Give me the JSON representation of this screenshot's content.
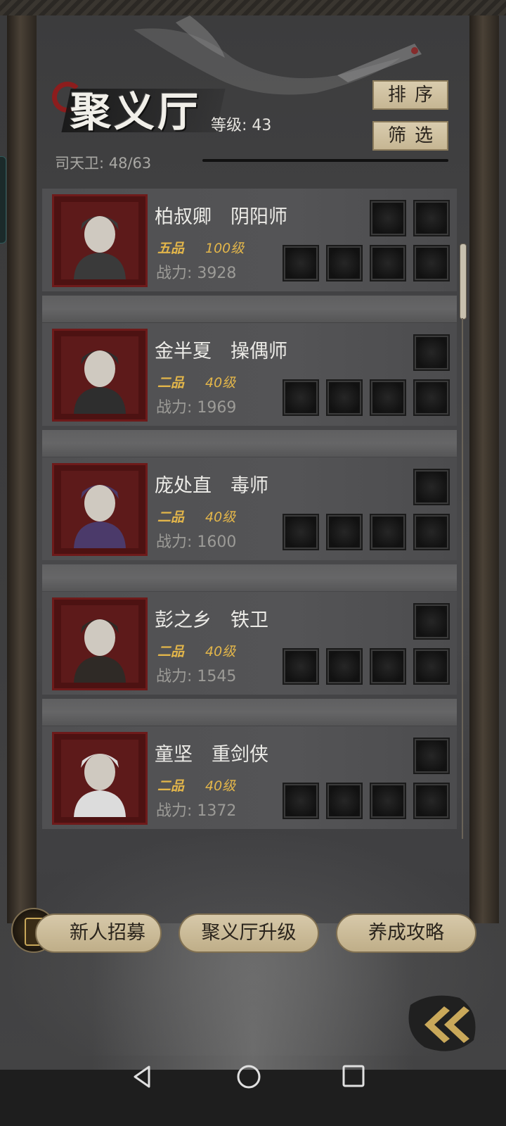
{
  "header": {
    "title": "聚义厅",
    "level_label": "等级: 43",
    "guard_count": "司天卫: 48/63",
    "sort_label": "排序",
    "filter_label": "筛选"
  },
  "characters": [
    {
      "name": "柏叔卿　阴阳师",
      "rank": "五品",
      "level": "100级",
      "power": "战力: 3928",
      "top_slots": 2
    },
    {
      "name": "金半夏　操偶师",
      "rank": "二品",
      "level": "40级",
      "power": "战力: 1969",
      "top_slots": 1
    },
    {
      "name": "庞处直　毒师",
      "rank": "二品",
      "level": "40级",
      "power": "战力: 1600",
      "top_slots": 1
    },
    {
      "name": "彭之乡　铁卫",
      "rank": "二品",
      "level": "40级",
      "power": "战力: 1545",
      "top_slots": 1
    },
    {
      "name": "童坚　重剑侠",
      "rank": "二品",
      "level": "40级",
      "power": "战力: 1372",
      "top_slots": 1
    }
  ],
  "bottom_buttons": {
    "recruit_label": "新人招募",
    "upgrade_label": "聚义厅升级",
    "guide_label": "养成攻略"
  },
  "icons": {
    "recruit": "token-icon",
    "back": "double-chevron-left-icon",
    "nav_back": "triangle-back-icon",
    "nav_home": "circle-home-icon",
    "nav_recent": "square-recent-icon"
  },
  "colors": {
    "rank_gold": "#e3b64a",
    "portrait_frame": "#6e1a1a",
    "button_parchment": "#d7c9aa"
  }
}
